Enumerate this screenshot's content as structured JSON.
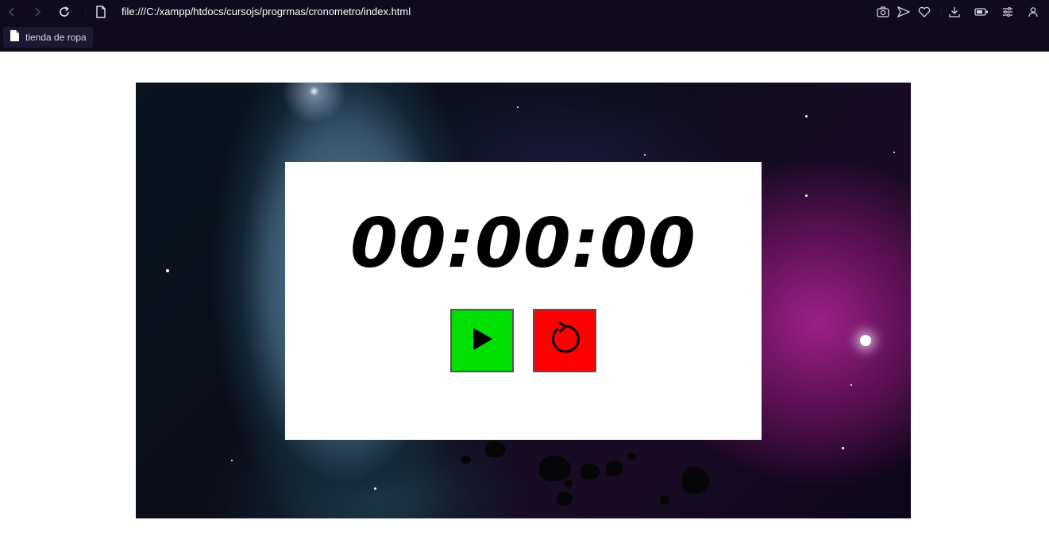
{
  "browser": {
    "url": "file:///C:/xampp/htdocs/cursojs/progrmas/cronometro/index.html",
    "bookmarks": [
      {
        "label": "tienda de ropa",
        "icon": "file-icon"
      }
    ],
    "toolbar_icons": [
      "back-icon",
      "forward-icon",
      "reload-icon",
      "page-info-icon",
      "camera-icon",
      "send-icon",
      "heart-icon",
      "download-icon",
      "battery-icon",
      "settings-icon",
      "profile-icon"
    ]
  },
  "stopwatch": {
    "time": "00:00:00",
    "play_button": {
      "icon": "play-icon",
      "color": "#00e000"
    },
    "reset_button": {
      "icon": "reset-icon",
      "color": "#ff0000"
    }
  }
}
